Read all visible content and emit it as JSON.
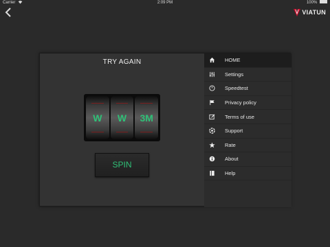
{
  "status_bar": {
    "carrier": "Carrier",
    "time": "2:09 PM",
    "battery": "100%"
  },
  "header": {
    "back_icon": "chevron-left-icon",
    "logo_text": "VIATUN",
    "brand_color": "#c8102e"
  },
  "game": {
    "title": "TRY AGAIN",
    "reels": [
      "W",
      "W",
      "3M"
    ],
    "spin_label": "SPIN",
    "accent_color": "#2fc077"
  },
  "menu": {
    "items": [
      {
        "label": "HOME",
        "icon": "home-icon",
        "active": true
      },
      {
        "label": "Settings",
        "icon": "sliders-icon"
      },
      {
        "label": "Speedtest",
        "icon": "speedometer-icon"
      },
      {
        "label": "Privacy policy",
        "icon": "flag-icon"
      },
      {
        "label": "Terms of use",
        "icon": "edit-icon"
      },
      {
        "label": "Support",
        "icon": "lifebuoy-icon"
      },
      {
        "label": "Rate",
        "icon": "star-icon"
      },
      {
        "label": "About",
        "icon": "info-icon"
      },
      {
        "label": "Help",
        "icon": "book-icon"
      }
    ]
  }
}
